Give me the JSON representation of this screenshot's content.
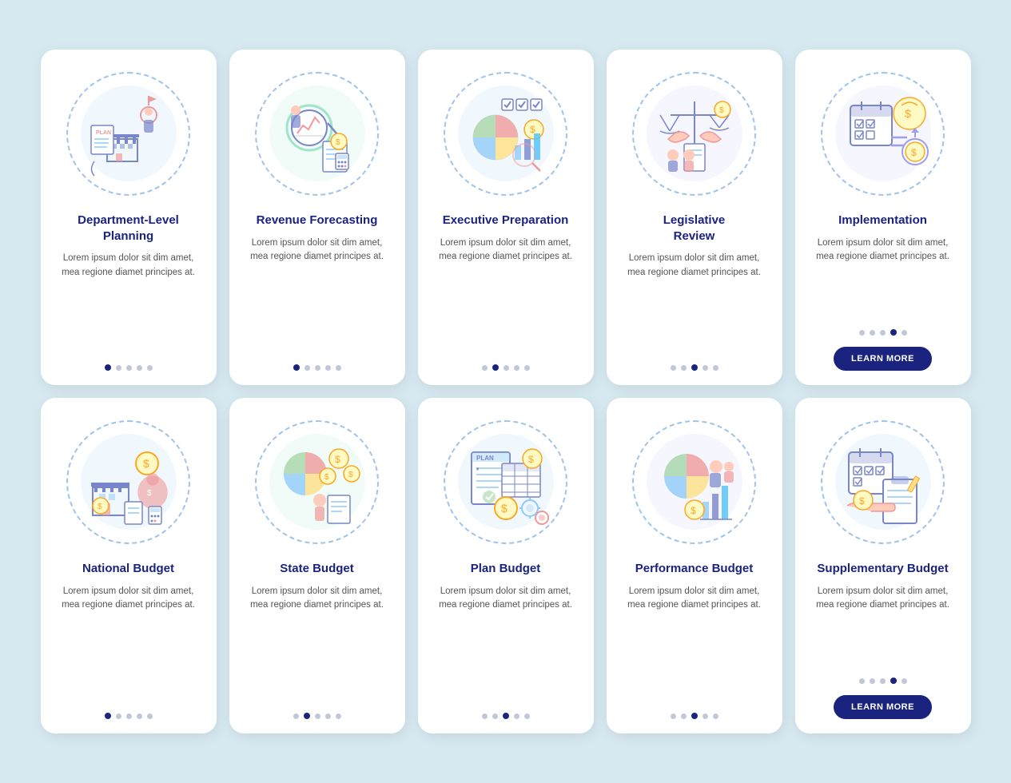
{
  "cards": [
    {
      "id": "dept-planning",
      "title": "Department-Level\nPlanning",
      "body": "Lorem ipsum dolor sit dim amet, mea regione diamet principes at.",
      "active_dot": 0,
      "show_button": false,
      "icon_color_bg": "#e8f4fb",
      "accent": "#4fc3f7"
    },
    {
      "id": "revenue-forecasting",
      "title": "Revenue\nForecasting",
      "body": "Lorem ipsum dolor sit dim amet, mea regione diamet principes at.",
      "active_dot": 0,
      "show_button": false,
      "icon_color_bg": "#e8f8f4",
      "accent": "#4dd0a0"
    },
    {
      "id": "executive-preparation",
      "title": "Executive\nPreparation",
      "body": "Lorem ipsum dolor sit dim amet, mea regione diamet principes at.",
      "active_dot": 1,
      "show_button": false,
      "icon_color_bg": "#e8f4fb",
      "accent": "#4fc3f7"
    },
    {
      "id": "legislative-review",
      "title": "Legislative\nReview",
      "body": "Lorem ipsum dolor sit dim amet, mea regione diamet principes at.",
      "active_dot": 2,
      "show_button": false,
      "icon_color_bg": "#f0f0ff",
      "accent": "#9c9cf0"
    },
    {
      "id": "implementation",
      "title": "Implementation",
      "body": "Lorem ipsum dolor sit dim amet, mea regione diamet principes at.",
      "active_dot": 3,
      "show_button": true,
      "icon_color_bg": "#f0f0ff",
      "accent": "#9c9cf0"
    },
    {
      "id": "national-budget",
      "title": "National\nBudget",
      "body": "Lorem ipsum dolor sit dim amet, mea regione diamet principes at.",
      "active_dot": 0,
      "show_button": false,
      "icon_color_bg": "#e8f4fb",
      "accent": "#4fc3f7"
    },
    {
      "id": "state-budget",
      "title": "State\nBudget",
      "body": "Lorem ipsum dolor sit dim amet, mea regione diamet principes at.",
      "active_dot": 1,
      "show_button": false,
      "icon_color_bg": "#e8f8f4",
      "accent": "#4dd0a0"
    },
    {
      "id": "plan-budget",
      "title": "Plan\nBudget",
      "body": "Lorem ipsum dolor sit dim amet, mea regione diamet principes at.",
      "active_dot": 2,
      "show_button": false,
      "icon_color_bg": "#e8f4fb",
      "accent": "#4fc3f7"
    },
    {
      "id": "performance-budget",
      "title": "Performance\nBudget",
      "body": "Lorem ipsum dolor sit dim amet, mea regione diamet principes at.",
      "active_dot": 2,
      "show_button": false,
      "icon_color_bg": "#f0f0ff",
      "accent": "#9c9cf0"
    },
    {
      "id": "supplementary-budget",
      "title": "Supplementary\nBudget",
      "body": "Lorem ipsum dolor sit dim amet, mea regione diamet principes at.",
      "active_dot": 3,
      "show_button": true,
      "icon_color_bg": "#e8f4fb",
      "accent": "#4fc3f7"
    }
  ],
  "button_label": "LEARN MORE",
  "dots_count": 5
}
